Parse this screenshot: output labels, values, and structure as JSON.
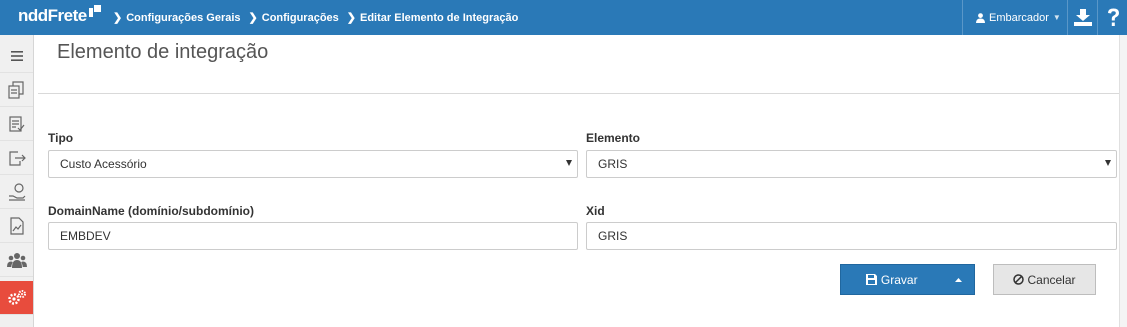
{
  "app": {
    "logo": "nddFrete"
  },
  "breadcrumb": [
    {
      "label": "Configurações Gerais"
    },
    {
      "label": "Configurações"
    },
    {
      "label": "Editar Elemento de Integração"
    }
  ],
  "header": {
    "user_label": "Embarcador",
    "download_icon": "download-icon",
    "help_icon": "help-icon",
    "brand_color": "#2a79b7"
  },
  "sidebar": {
    "items": [
      {
        "icon": "menu-icon"
      },
      {
        "icon": "documents-icon"
      },
      {
        "icon": "checklist-icon"
      },
      {
        "icon": "export-icon"
      },
      {
        "icon": "payment-icon"
      },
      {
        "icon": "report-icon"
      },
      {
        "icon": "users-icon"
      },
      {
        "icon": "settings-gears-icon",
        "active": true
      }
    ],
    "active_color": "#e84c3d"
  },
  "main": {
    "title": "Elemento de integração",
    "form": {
      "tipo": {
        "label": "Tipo",
        "value": "Custo Acessório"
      },
      "elemento": {
        "label": "Elemento",
        "value": "GRIS"
      },
      "domain": {
        "label": "DomainName (domínio/subdomínio)",
        "value": "EMBDEV"
      },
      "xid": {
        "label": "Xid",
        "value": "GRIS"
      }
    },
    "buttons": {
      "save_label": "Gravar",
      "cancel_label": "Cancelar"
    }
  }
}
